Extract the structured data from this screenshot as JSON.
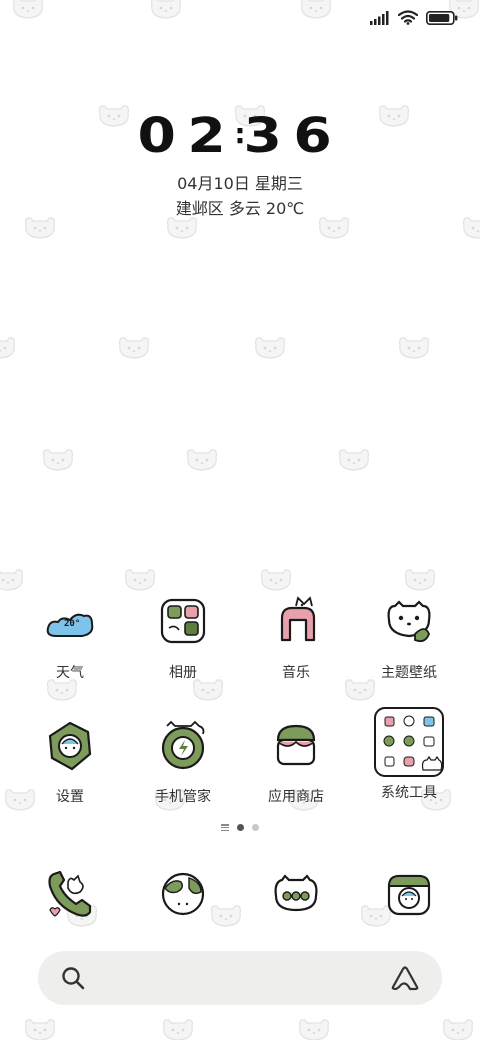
{
  "status_bar": {
    "signal_icon": "cellular-signal-icon",
    "wifi_icon": "wifi-icon",
    "battery_icon": "battery-icon",
    "battery_level": 0.9
  },
  "lock_widget": {
    "time_hours": "02",
    "time_minutes": "36",
    "date": "04月10日 星期三",
    "weather": "建邺区 多云 20℃"
  },
  "apps_row1": [
    {
      "label": "天气",
      "icon": "weather-icon"
    },
    {
      "label": "相册",
      "icon": "gallery-icon"
    },
    {
      "label": "音乐",
      "icon": "music-icon"
    },
    {
      "label": "主题壁纸",
      "icon": "themes-icon"
    }
  ],
  "apps_row2": [
    {
      "label": "设置",
      "icon": "settings-icon"
    },
    {
      "label": "手机管家",
      "icon": "security-icon"
    },
    {
      "label": "应用商店",
      "icon": "app-store-icon"
    },
    {
      "label": "系统工具",
      "icon": "system-tools-folder-icon"
    }
  ],
  "page_indicator": {
    "pages": 3,
    "active": 1
  },
  "dock": [
    {
      "icon": "phone-icon"
    },
    {
      "icon": "browser-icon"
    },
    {
      "icon": "messages-icon"
    },
    {
      "icon": "camera-icon"
    }
  ],
  "search_bar": {
    "search_icon": "search-icon",
    "assistant_icon": "assistant-icon"
  },
  "colors": {
    "icon_green": "#7d9b5a",
    "icon_dark_green": "#5f7d40",
    "icon_pink": "#e8a1ab",
    "icon_blue": "#7ec3ea",
    "outline": "#1a1a1a",
    "search_bg": "#eeeeec"
  }
}
